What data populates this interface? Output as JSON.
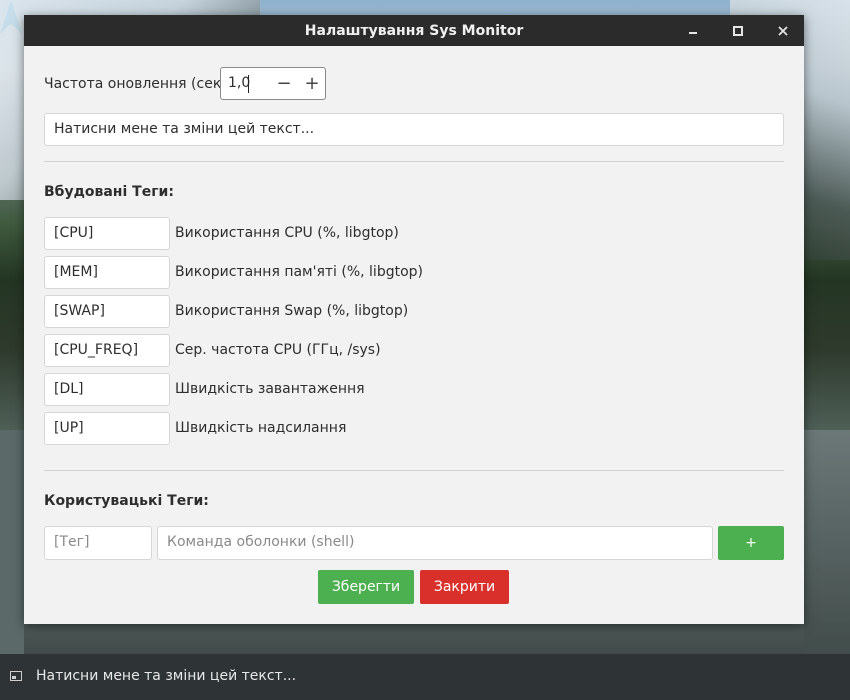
{
  "window": {
    "title": "Налаштування Sys Monitor"
  },
  "refresh": {
    "label": "Частота оновлення (сек.):",
    "value": "1,0",
    "minus": "−",
    "plus": "+"
  },
  "text_entry": {
    "value": "Натисни мене та зміни цей текст..."
  },
  "builtin": {
    "heading": "Вбудовані Теги:",
    "tags": [
      {
        "tag": "[CPU]",
        "desc": "Використання CPU (%, libgtop)"
      },
      {
        "tag": "[MEM]",
        "desc": "Використання пам'яті (%, libgtop)"
      },
      {
        "tag": "[SWAP]",
        "desc": "Використання Swap (%, libgtop)"
      },
      {
        "tag": "[CPU_FREQ]",
        "desc": "Сер. частота CPU (ГГц, /sys)"
      },
      {
        "tag": "[DL]",
        "desc": "Швидкість завантаження"
      },
      {
        "tag": "[UP]",
        "desc": "Швидкість надсилання"
      }
    ]
  },
  "custom": {
    "heading": "Користувацькі Теги:",
    "tag_placeholder": "[Тег]",
    "command_placeholder": "Команда оболонки (shell)",
    "add_label": "+"
  },
  "actions": {
    "save": "Зберегти",
    "close": "Закрити"
  },
  "taskbar": {
    "text": "Натисни мене та зміни цей текст..."
  },
  "colors": {
    "green": "#4caf50",
    "red": "#d9302c",
    "titlebar": "#2b2b2b",
    "taskbar": "#2e3436",
    "logo": "#1793d1"
  }
}
